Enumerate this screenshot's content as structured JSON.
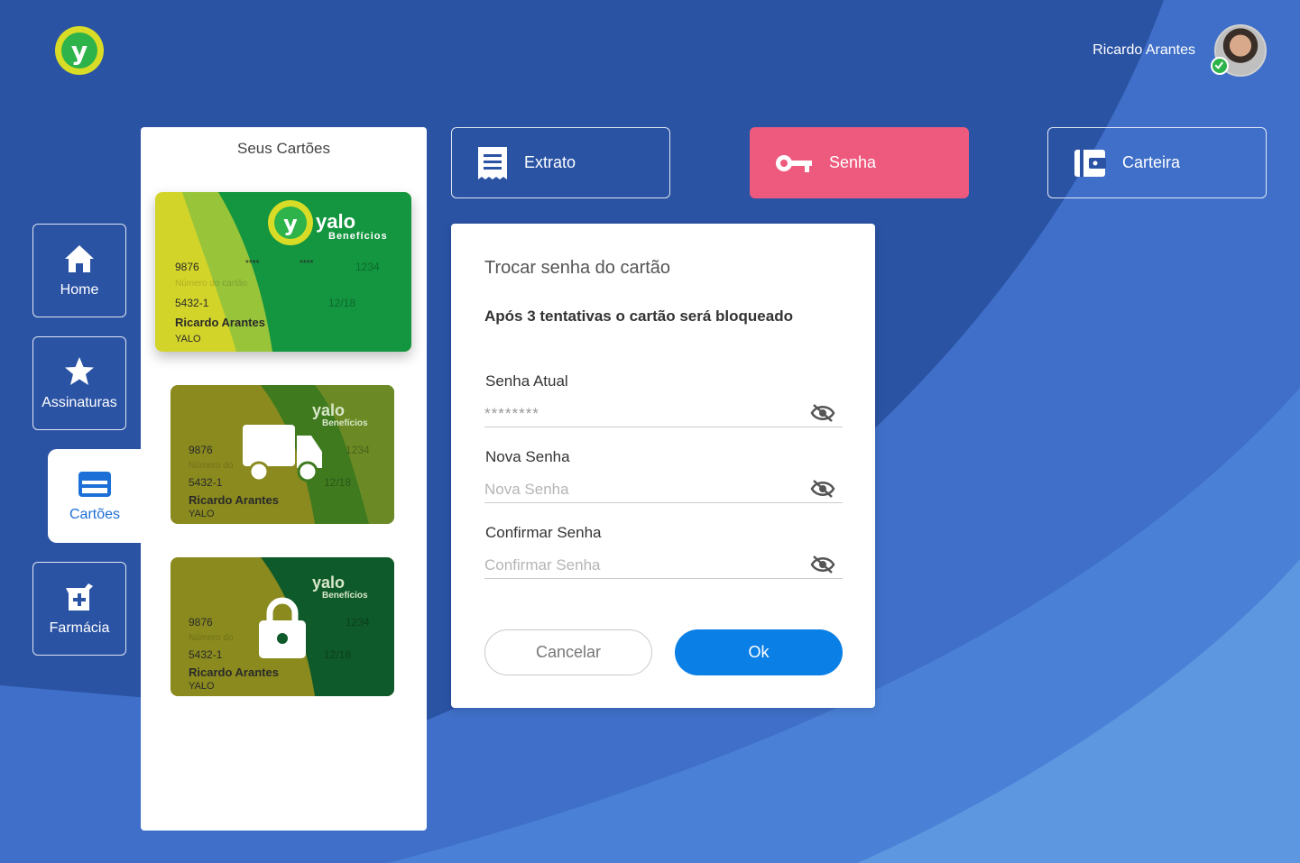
{
  "user": {
    "name": "Ricardo Arantes",
    "verified": true
  },
  "brand": {
    "logo_letter": "y",
    "card_brand": "yalo",
    "card_sub": "Benefícios"
  },
  "nav": {
    "home": "Home",
    "assinaturas": "Assinaturas",
    "cartoes": "Cartões",
    "farmacia": "Farmácia"
  },
  "cards_panel": {
    "title": "Seus Cartões",
    "cards": [
      {
        "num_left": "9876",
        "mask1": "****",
        "mask2": "****",
        "num_right": "1234",
        "number_label": "Número do cartão",
        "account": "5432-1",
        "expiry": "12/18",
        "holder": "Ricardo Arantes",
        "issuer": "YALO",
        "status": "active"
      },
      {
        "num_left": "9876",
        "num_right": "1234",
        "number_label": "Número do",
        "account": "5432-1",
        "expiry": "12/18",
        "holder": "Ricardo Arantes",
        "issuer": "YALO",
        "status": "in-transit"
      },
      {
        "num_left": "9876",
        "num_right": "1234",
        "number_label": "Número do",
        "account": "5432-1",
        "expiry": "12/18",
        "holder": "Ricardo Arantes",
        "issuer": "YALO",
        "status": "locked"
      }
    ]
  },
  "actions": {
    "extrato": "Extrato",
    "senha": "Senha",
    "carteira": "Carteira"
  },
  "dialog": {
    "title": "Trocar senha do cartão",
    "warning": "Após 3 tentativas o cartão será bloqueado",
    "current_label": "Senha Atual",
    "current_value": "********",
    "new_label": "Nova Senha",
    "new_placeholder": "Nova Senha",
    "confirm_label": "Confirmar Senha",
    "confirm_placeholder": "Confirmar Senha",
    "cancel": "Cancelar",
    "ok": "Ok"
  },
  "colors": {
    "background": "#2b53a4",
    "accent_pink": "#ee5a7e",
    "primary_blue": "#0a7fe6",
    "brand_green": "#119a43",
    "brand_yellow": "#d9dc26"
  }
}
